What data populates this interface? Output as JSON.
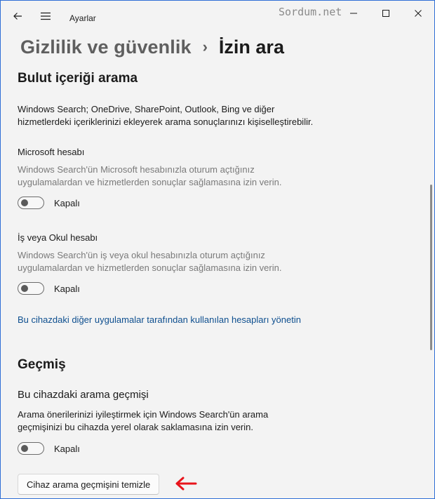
{
  "app": {
    "title": "Ayarlar",
    "watermark": "Sordum.net"
  },
  "breadcrumb": {
    "parent": "Gizlilik ve güvenlik",
    "separator": "›",
    "current": "İzin ara"
  },
  "cloud": {
    "title": "Bulut içeriği arama",
    "description_line1": "Windows Search; OneDrive, SharePoint, Outlook, Bing ve diğer",
    "description_line2": "hizmetlerdeki içeriklerinizi ekleyerek arama sonuçlarınızı kişiselleştirebilir.",
    "microsoft": {
      "label": "Microsoft hesabı",
      "desc_line1": "Windows Search'ün Microsoft hesabınızla oturum açtığınız",
      "desc_line2": "uygulamalardan ve hizmetlerden sonuçlar sağlamasına izin verin.",
      "toggle_state": "Kapalı"
    },
    "work": {
      "label": "İş veya Okul hesabı",
      "desc_line1": "Windows Search'ün iş veya okul hesabınızla oturum açtığınız",
      "desc_line2": "uygulamalardan ve hizmetlerden sonuçlar sağlamasına izin verin.",
      "toggle_state": "Kapalı"
    },
    "manage_link": "Bu cihazdaki diğer uygulamalar tarafından kullanılan hesapları yönetin"
  },
  "history": {
    "title": "Geçmiş",
    "label": "Bu cihazdaki arama geçmişi",
    "desc_line1": "Arama önerilerinizi iyileştirmek için Windows Search'ün arama",
    "desc_line2": "geçmişinizi bu cihazda yerel olarak saklamasına izin verin.",
    "toggle_state": "Kapalı",
    "clear_button": "Cihaz arama geçmişini temizle"
  },
  "colors": {
    "accent_link": "#0e4f8f",
    "annotation_arrow": "#e8141b",
    "window_border": "#2f6fd6"
  },
  "icons": {
    "back": "back-arrow-icon",
    "menu": "hamburger-menu-icon",
    "minimize": "minimize-icon",
    "maximize": "maximize-icon",
    "close": "close-icon",
    "annotation": "red-arrow-icon"
  }
}
